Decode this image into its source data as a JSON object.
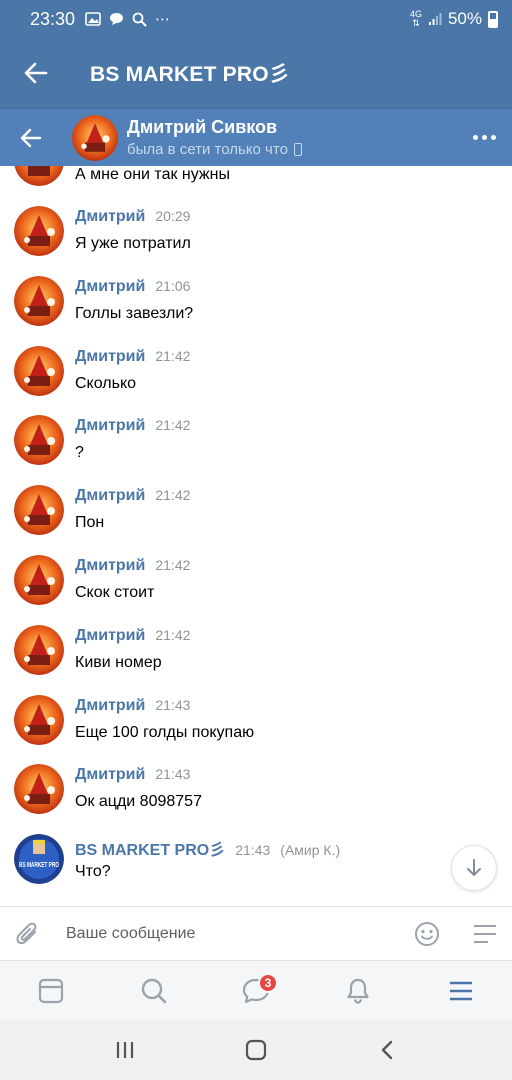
{
  "status_bar": {
    "time": "23:30",
    "network_label": "4G",
    "battery": "50%"
  },
  "app_header": {
    "title": "BS MARKET PRO彡",
    "back_icon": "arrow-left-icon"
  },
  "chat_header": {
    "name": "Дмитрий Сивков",
    "status": "была в сети только что"
  },
  "first_message_text": "А мне они так нужны",
  "messages": [
    {
      "author": "Дмитрий",
      "time": "20:29",
      "text": "Я уже потратил"
    },
    {
      "author": "Дмитрий",
      "time": "21:06",
      "text": "Голлы завезли?"
    },
    {
      "author": "Дмитрий",
      "time": "21:42",
      "text": "Сколько"
    },
    {
      "author": "Дмитрий",
      "time": "21:42",
      "text": "?"
    },
    {
      "author": "Дмитрий",
      "time": "21:42",
      "text": "Пон"
    },
    {
      "author": "Дмитрий",
      "time": "21:42",
      "text": "Скок стоит"
    },
    {
      "author": "Дмитрий",
      "time": "21:42",
      "text": "Киви номер"
    },
    {
      "author": "Дмитрий",
      "time": "21:43",
      "text": "Еще 100 голды покупаю"
    },
    {
      "author": "Дмитрий",
      "time": "21:43",
      "text": "Ок ацди 8098757"
    },
    {
      "author": "BS MARKET PRO彡",
      "time": "21:43",
      "extra": "(Амир К.)",
      "text": "Что?"
    }
  ],
  "bs_avatar_text": "BS MARKET PRO",
  "composer": {
    "placeholder": "Ваше сообщение"
  },
  "tabbar": {
    "messages_badge": "3"
  },
  "colors": {
    "header_bg": "#4a76a8",
    "chat_header_bg": "#5181b8",
    "author_color": "#4a76a8",
    "badge_red": "#e64646"
  }
}
